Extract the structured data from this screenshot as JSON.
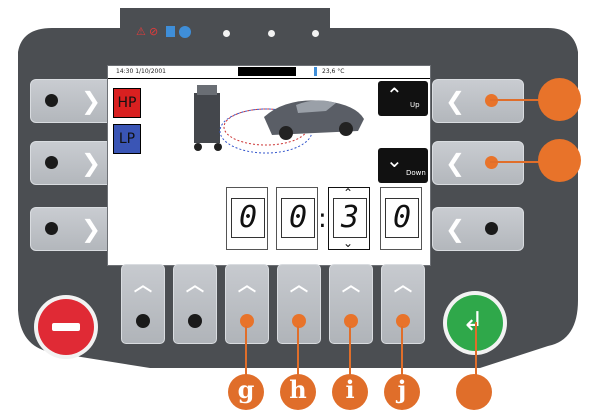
{
  "status_bar": {
    "datetime": "14:30 1/10/2001",
    "temperature": "23,6 °C"
  },
  "pressure": {
    "hp_label": "HP",
    "lp_label": "LP"
  },
  "nav": {
    "up_label": "Up",
    "down_label": "Down"
  },
  "timer": {
    "digits": [
      "0",
      "0",
      "3",
      "0"
    ],
    "separator": ":"
  },
  "callouts": {
    "g": "g",
    "h": "h",
    "i": "i",
    "j": "j"
  },
  "colors": {
    "panel": "#4b4e52",
    "orange": "#e8732a",
    "hp_red": "#d92020",
    "lp_blue": "#3a55b5",
    "stop_red": "#e02a35",
    "enter_green": "#2fa84a"
  },
  "icons": [
    "warning-icon",
    "no-entry-icon",
    "refrigerant-icon",
    "service-icon",
    "thermometer-icon",
    "enter-icon",
    "minus-icon"
  ]
}
